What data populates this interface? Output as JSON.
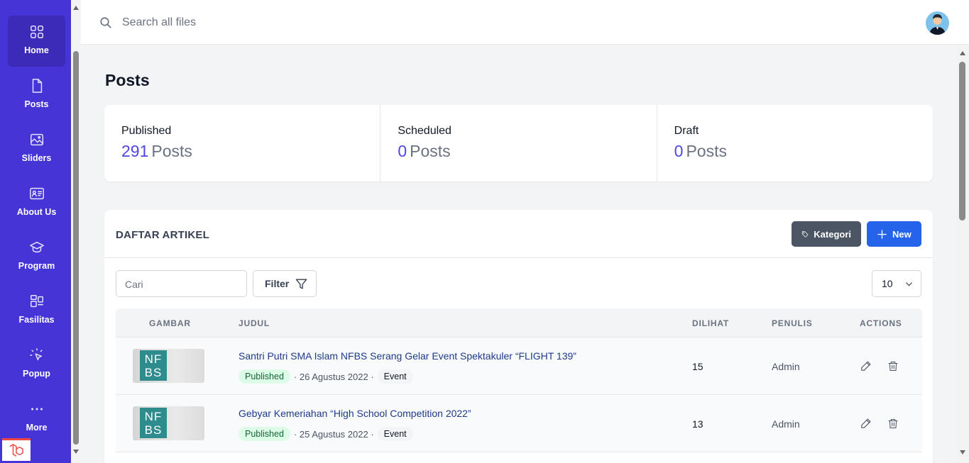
{
  "sidebar": {
    "items": [
      {
        "label": "Home",
        "icon": "grid-icon"
      },
      {
        "label": "Posts",
        "icon": "document-icon"
      },
      {
        "label": "Sliders",
        "icon": "image-icon"
      },
      {
        "label": "About Us",
        "icon": "id-card-icon"
      },
      {
        "label": "Program",
        "icon": "graduation-cap-icon"
      },
      {
        "label": "Fasilitas",
        "icon": "layout-icon"
      },
      {
        "label": "Popup",
        "icon": "cursor-click-icon"
      },
      {
        "label": "More",
        "icon": "ellipsis-icon"
      }
    ]
  },
  "header": {
    "search_placeholder": "Search all files"
  },
  "page": {
    "title": "Posts"
  },
  "stats": [
    {
      "label": "Published",
      "count": "291",
      "unit": "Posts"
    },
    {
      "label": "Scheduled",
      "count": "0",
      "unit": "Posts"
    },
    {
      "label": "Draft",
      "count": "0",
      "unit": "Posts"
    }
  ],
  "articles": {
    "title": "DAFTAR ARTIKEL",
    "kategori_label": "Kategori",
    "new_label": "New",
    "search_placeholder": "Cari",
    "filter_label": "Filter",
    "per_page": "10",
    "columns": [
      "GAMBAR",
      "JUDUL",
      "DILIHAT",
      "PENULIS",
      "ACTIONS"
    ],
    "rows": [
      {
        "logo_top": "NF",
        "logo_bottom": "BS",
        "title": "Santri Putri SMA Islam NFBS Serang Gelar Event Spektakuler “FLIGHT 139”",
        "status": "Published",
        "date": "· 26 Agustus 2022 ·",
        "category": "Event",
        "views": "15",
        "author": "Admin"
      },
      {
        "logo_top": "NF",
        "logo_bottom": "BS",
        "title": "Gebyar Kemeriahan “High School Competition 2022”",
        "status": "Published",
        "date": "· 25 Agustus 2022 ·",
        "category": "Event",
        "views": "13",
        "author": "Admin"
      }
    ]
  },
  "colors": {
    "sidebar": "#4535d6",
    "sidebar_active": "#3b2bb8",
    "accent": "#4f46e5",
    "primary_button": "#2563eb",
    "secondary_button": "#4b5563",
    "published_badge": "#dcfce7"
  }
}
